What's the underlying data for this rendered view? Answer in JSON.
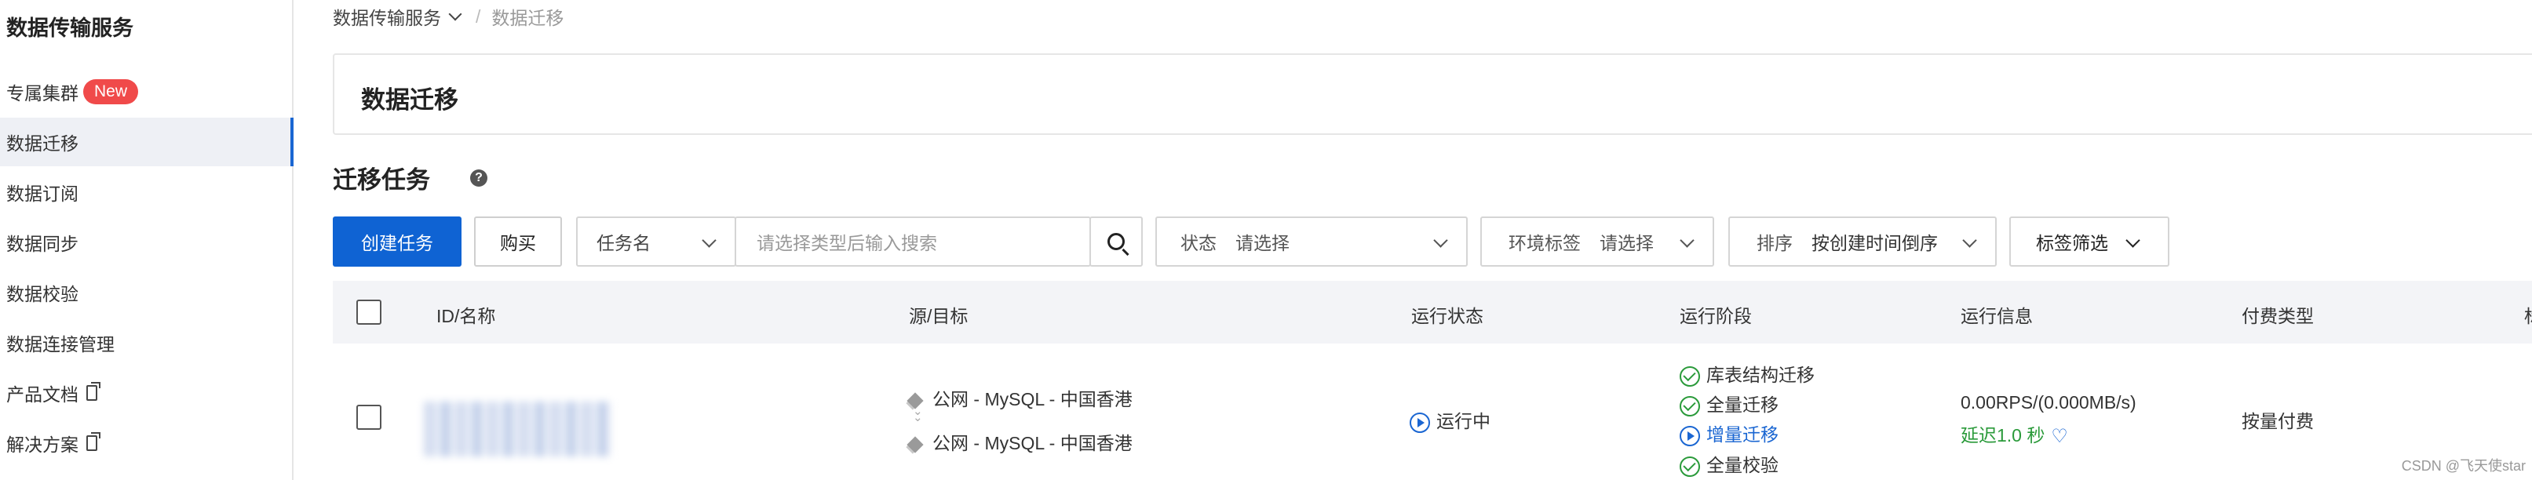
{
  "sidebar": {
    "title": "数据传输服务",
    "items": [
      {
        "label": "专属集群",
        "badge": "New"
      },
      {
        "label": "数据迁移",
        "active": true
      },
      {
        "label": "数据订阅"
      },
      {
        "label": "数据同步"
      },
      {
        "label": "数据校验"
      },
      {
        "label": "数据连接管理"
      },
      {
        "label": "产品文档",
        "external": true
      },
      {
        "label": "解决方案",
        "external": true
      }
    ]
  },
  "breadcrumb": {
    "root": "数据传输服务",
    "separator": "/",
    "current": "数据迁移"
  },
  "page": {
    "title": "数据迁移",
    "section_title": "迁移任务",
    "help": "?"
  },
  "toolbar": {
    "create_label": "创建任务",
    "buy_label": "购买",
    "type_select": "任务名",
    "search_placeholder": "请选择类型后输入搜索",
    "status_label": "状态",
    "status_placeholder": "请选择",
    "env_label": "环境标签",
    "env_placeholder": "请选择",
    "sort_label": "排序",
    "sort_value": "按创建时间倒序",
    "tag_filter_label": "标签筛选"
  },
  "table": {
    "columns": [
      "ID/名称",
      "源/目标",
      "运行状态",
      "运行阶段",
      "运行信息",
      "付费类型",
      "标"
    ],
    "rows": [
      {
        "source": "公网 - MySQL - 中国香港",
        "target": "公网 - MySQL - 中国香港",
        "status": "运行中",
        "stages": [
          {
            "label": "库表结构迁移",
            "state": "done"
          },
          {
            "label": "全量迁移",
            "state": "done"
          },
          {
            "label": "增量迁移",
            "state": "running"
          },
          {
            "label": "全量校验",
            "state": "done"
          }
        ],
        "info_rate": "0.00RPS/(0.000MB/s)",
        "info_delay": "延迟1.0 秒",
        "billing": "按量付费"
      }
    ]
  },
  "watermark": "CSDN @飞天使star",
  "colors": {
    "primary": "#0f63d3",
    "success": "#2a9a3a",
    "badge": "#f04a4a"
  }
}
